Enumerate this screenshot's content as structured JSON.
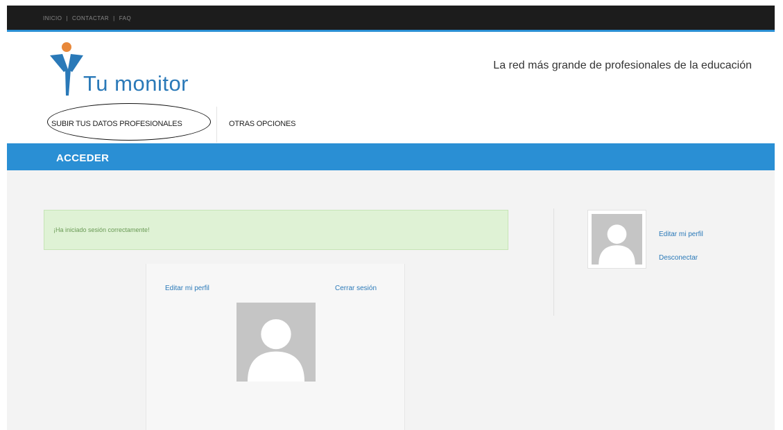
{
  "topnav": {
    "items": [
      "INICIO",
      "CONTACTAR",
      "FAQ"
    ],
    "separator": "|"
  },
  "header": {
    "logo_text": "Tu monitor",
    "tagline": "La red más grande de profesionales de la educación"
  },
  "mainnav": {
    "items": [
      "SUBIR TUS DATOS PROFESIONALES",
      "OTRAS OPCIONES"
    ]
  },
  "page": {
    "title": "ACCEDER"
  },
  "alert": {
    "message": "¡Ha iniciado sesión correctamente!"
  },
  "card": {
    "edit_profile": "Editar mi perfil",
    "logout": "Cerrar sesión",
    "avatar_icon": "default-user-avatar-icon"
  },
  "sidebar": {
    "edit_profile": "Editar mi perfil",
    "logout": "Desconectar",
    "avatar_icon": "default-user-avatar-icon"
  },
  "colors": {
    "topbar": "#1c1c1c",
    "accent_blue": "#2a8fd4",
    "link_blue": "#2a79b8",
    "logo_orange": "#e8883a",
    "alert_bg": "#dff2d5",
    "alert_text": "#6a9a55",
    "content_bg": "#f3f3f3",
    "avatar_gray": "#c5c5c5"
  }
}
